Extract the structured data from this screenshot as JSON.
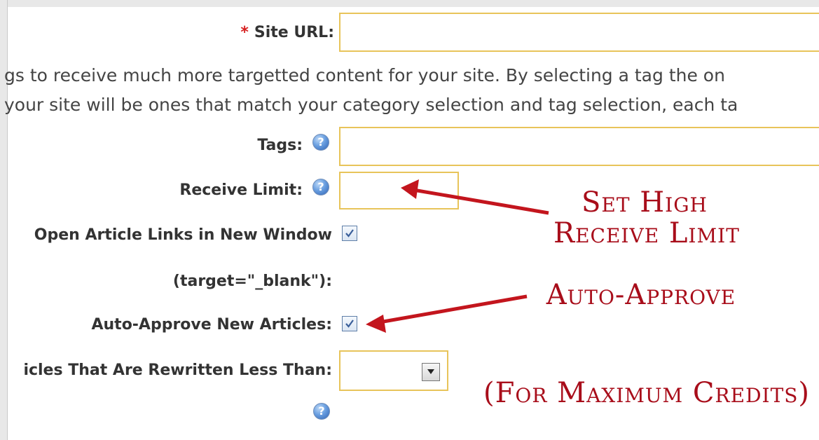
{
  "form": {
    "site_url": {
      "required_mark": "*",
      "label": "Site URL:",
      "value": ""
    },
    "description": {
      "line1": "gs to receive much more targetted content for your site. By selecting a tag the on",
      "line2": "your site will be ones that match your category selection and tag selection, each ta"
    },
    "tags": {
      "label": "Tags:",
      "value": ""
    },
    "receive_limit": {
      "label": "Receive Limit:",
      "value": ""
    },
    "open_links": {
      "label": "Open Article Links in New Window",
      "label2": "(target=\"_blank\"):",
      "checked": true
    },
    "auto_approve": {
      "label": "Auto-Approve New Articles:",
      "checked": true
    },
    "rewritten_less_than": {
      "label": "icles That Are Rewritten Less Than:",
      "value": ""
    },
    "help_icon_glyph": "?"
  },
  "annotations": {
    "set_high_line1": "Set High",
    "set_high_line2": "Receive Limit",
    "auto_approve": "Auto-Approve",
    "max_credits": "(For Maximum Credits)",
    "color": "#a80d1a"
  },
  "colors": {
    "field_border": "#e8c45a",
    "label_text": "#333333",
    "required": "#d62020"
  }
}
